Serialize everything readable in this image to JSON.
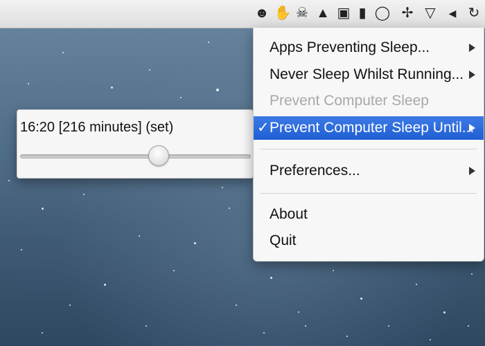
{
  "menubar": {
    "icons": [
      {
        "name": "caffeine-app-icon",
        "glyph": "☻"
      },
      {
        "name": "evernote-icon",
        "glyph": "✋"
      },
      {
        "name": "skull-crossbones-icon",
        "glyph": "☠"
      },
      {
        "name": "drive-icon",
        "glyph": "▲"
      },
      {
        "name": "tv-robot-icon",
        "glyph": "▣"
      },
      {
        "name": "bookmark-icon",
        "glyph": "▮"
      },
      {
        "name": "chat-bubble-icon",
        "glyph": "◯"
      },
      {
        "name": "compass-icon",
        "glyph": "✢"
      },
      {
        "name": "wifi-icon",
        "glyph": "▽"
      },
      {
        "name": "volume-icon",
        "glyph": "◀"
      },
      {
        "name": "time-machine-icon",
        "glyph": "↻"
      }
    ]
  },
  "menu": {
    "items": [
      {
        "label": "Apps Preventing Sleep...",
        "submenu": true,
        "state": "normal"
      },
      {
        "label": "Never Sleep Whilst Running...",
        "submenu": true,
        "state": "normal"
      },
      {
        "label": "Prevent Computer Sleep",
        "submenu": false,
        "state": "disabled"
      },
      {
        "label": "Prevent Computer Sleep Until...",
        "submenu": true,
        "state": "highlighted",
        "checked": true,
        "checkmark": "✓"
      },
      {
        "label": "Preferences...",
        "submenu": true,
        "state": "normal"
      },
      {
        "label": "About",
        "submenu": false,
        "state": "normal"
      },
      {
        "label": "Quit",
        "submenu": false,
        "state": "normal"
      }
    ]
  },
  "timer_popup": {
    "text": "16:20 [216 minutes] (set)",
    "slider_value": 0.6
  },
  "colors": {
    "highlight": "#2f6fd6",
    "disabled_text": "#a8a8a8"
  }
}
